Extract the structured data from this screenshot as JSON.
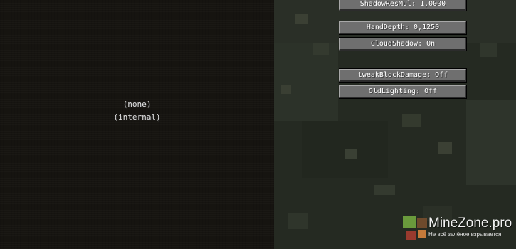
{
  "shader_packs": {
    "items": [
      {
        "label": "(none)"
      },
      {
        "label": "(internal)"
      }
    ]
  },
  "options": [
    {
      "label": "ShadowResMul: 1,0000"
    },
    {
      "label": "HandDepth: 0,1250"
    },
    {
      "label": "CloudShadow: On"
    },
    {
      "label": "tweakBlockDamage: Off"
    },
    {
      "label": "OldLighting: Off"
    }
  ],
  "watermark": {
    "title": "MineZone.pro",
    "tagline": "Не всё зелёное взрывается",
    "colors": {
      "green": "#6a9a3c",
      "brown": "#6e4a2c",
      "orange": "#c67a3a",
      "red": "#9a3a2e"
    }
  },
  "colors": {
    "left_background": "#161410",
    "world_background": "#252a22",
    "button_face": "#6f6f6f",
    "button_text": "#ffffff",
    "list_text": "#e0e0e0"
  }
}
